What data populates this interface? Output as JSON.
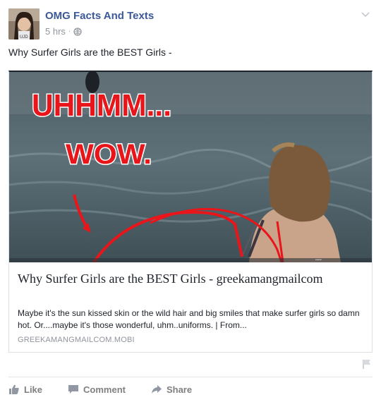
{
  "post": {
    "page_name": "OMG Facts And Texts",
    "time": "5 hrs",
    "separator": "·",
    "text": "Why Surfer Girls are the BEST Girls -"
  },
  "image_overlay": {
    "line1": "UHHMM...",
    "line2": "WOW."
  },
  "link": {
    "title": "Why Surfer Girls are the BEST Girls - greekamangmailcom",
    "description": "Maybe it's the sun kissed skin or the wild hair and big smiles that make surfer girls so damn hot. Or....maybe it's those wonderful, uhm..uniforms. | From...",
    "domain": "GREEKAMANGMAILCOM.MOBI"
  },
  "actions": {
    "like": "Like",
    "comment": "Comment",
    "share": "Share"
  },
  "colors": {
    "page_name": "#3b5998",
    "meta": "#90949c",
    "overlay_text": "#e8161a",
    "annotation": "#e8161a"
  },
  "icons": [
    "globe-icon",
    "chevron-down-icon",
    "flag-icon",
    "like-icon",
    "comment-icon",
    "share-icon"
  ]
}
